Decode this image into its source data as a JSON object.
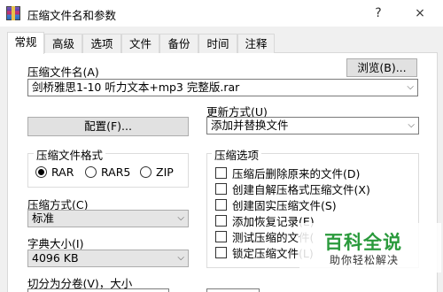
{
  "window": {
    "title": "压缩文件名和参数",
    "help_glyph": "?",
    "close_glyph": "×"
  },
  "tabs": [
    {
      "label": "常规",
      "active": true
    },
    {
      "label": "高级"
    },
    {
      "label": "选项"
    },
    {
      "label": "文件"
    },
    {
      "label": "备份"
    },
    {
      "label": "时间"
    },
    {
      "label": "注释"
    }
  ],
  "general": {
    "archive_name_label": "压缩文件名(A)",
    "browse_label": "浏览(B)...",
    "archive_name_value": "剑桥雅思1-10 听力文本+mp3 完整版.rar",
    "update_mode_label": "更新方式(U)",
    "update_mode_value": "添加并替换文件",
    "profiles_label": "配置(F)...",
    "format_group_title": "压缩文件格式",
    "formats": [
      {
        "label": "RAR",
        "checked": true
      },
      {
        "label": "RAR5",
        "checked": false
      },
      {
        "label": "ZIP",
        "checked": false
      }
    ],
    "method_label": "压缩方式(C)",
    "method_value": "标准",
    "dict_label": "字典大小(I)",
    "dict_value": "4096 KB",
    "split_label": "切分为分卷(V)，大小",
    "options_group_title": "压缩选项",
    "options": [
      {
        "label": "压缩后删除原来的文件(D)",
        "checked": false
      },
      {
        "label": "创建自解压格式压缩文件(X)",
        "checked": false
      },
      {
        "label": "创建固实压缩文件(S)",
        "checked": false
      },
      {
        "label": "添加恢复记录(E)",
        "checked": false
      },
      {
        "label": "测试压缩的文件(",
        "checked": false
      },
      {
        "label": "锁定压缩文件(L)",
        "checked": false
      }
    ]
  },
  "watermark": {
    "title": "百科全说",
    "subtitle": "助你轻松解决"
  }
}
